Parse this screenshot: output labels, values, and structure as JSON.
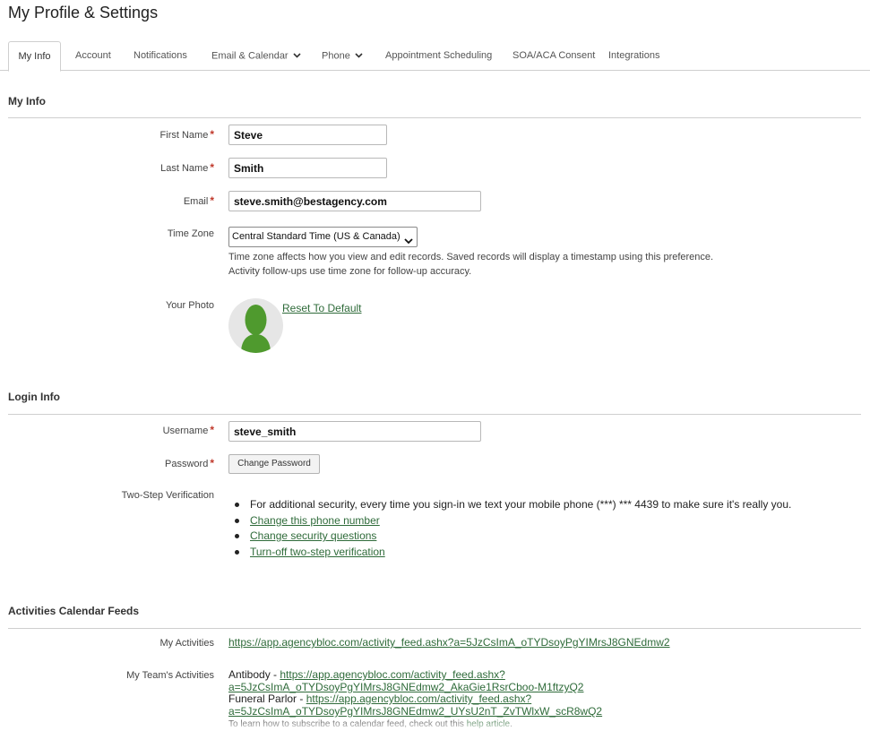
{
  "page_title": "My Profile & Settings",
  "tabs": [
    {
      "label": "My Info",
      "active": true
    },
    {
      "label": "Account"
    },
    {
      "label": "Notifications"
    },
    {
      "label": "Email & Calendar",
      "has_dropdown": true
    },
    {
      "label": "Phone",
      "has_dropdown": true
    },
    {
      "label": "Appointment Scheduling"
    },
    {
      "label": "SOA/ACA Consent"
    },
    {
      "label": "Integrations"
    }
  ],
  "my_info": {
    "title": "My Info",
    "first_name_label": "First Name",
    "first_name_value": "Steve",
    "last_name_label": "Last Name",
    "last_name_value": "Smith",
    "email_label": "Email",
    "email_value": "steve.smith@bestagency.com",
    "time_zone_label": "Time Zone",
    "time_zone_value": "Central Standard Time (US & Canada)",
    "time_zone_help_1": "Time zone affects how you view and edit records. Saved records will display a timestamp using this preference.",
    "time_zone_help_2": "Activity follow-ups use time zone for follow-up accuracy.",
    "photo_label": "Your Photo",
    "reset_label": "Reset To Default"
  },
  "login_info": {
    "title": "Login Info",
    "username_label": "Username",
    "username_value": "steve_smith",
    "password_label": "Password",
    "change_password_label": "Change Password",
    "two_step_label": "Two-Step Verification",
    "two_step_text": "For additional security, every time you sign-in we text your mobile phone (***) *** 4439 to make sure it's really you.",
    "change_phone_link": "Change this phone number",
    "change_questions_link": "Change security questions",
    "turn_off_link": "Turn-off two-step verification"
  },
  "calendar_feeds": {
    "title": "Activities Calendar Feeds",
    "my_activities_label": "My Activities",
    "my_activities_url": "https://app.agencybloc.com/activity_feed.ashx?a=5JzCsImA_oTYDsoyPgYIMrsJ8GNEdmw2",
    "team_label": "My Team's Activities",
    "team_1_name": "Antibody - ",
    "team_1_url_line1": "https://app.agencybloc.com/activity_feed.ashx?",
    "team_1_url_line2": "a=5JzCsImA_oTYDsoyPgYIMrsJ8GNEdmw2_AkaGie1RsrCboo-M1ftzyQ2",
    "team_2_name": "Funeral Parlor - ",
    "team_2_url_line1": "https://app.agencybloc.com/activity_feed.ashx?",
    "team_2_url_line2": "a=5JzCsImA_oTYDsoyPgYIMrsJ8GNEdmw2_UYsU2nT_ZvTWlxW_scR8wQ2",
    "footnote_text": "To learn how to subscribe to a calendar feed, check out this ",
    "footnote_link": "help article",
    "footnote_end": "."
  },
  "colors": {
    "link": "#2f6b3a",
    "required": "#c0392b",
    "avatar_green": "#4f9a2e"
  }
}
